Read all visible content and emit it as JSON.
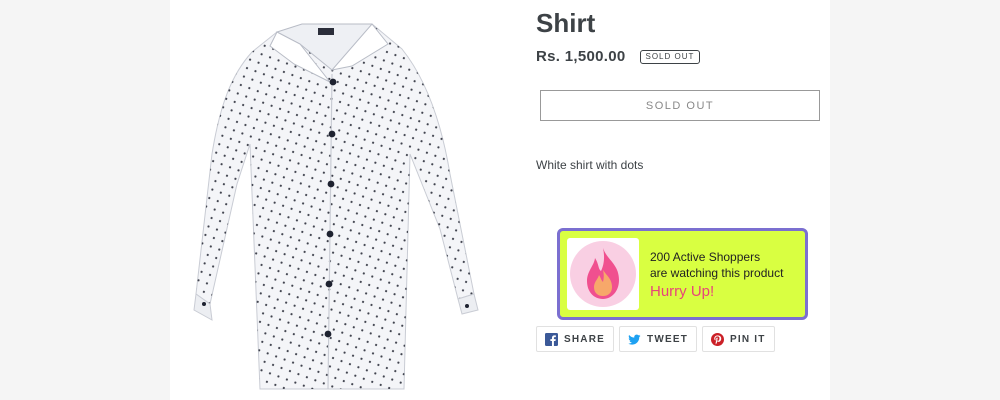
{
  "product": {
    "title": "Shirt",
    "price": "Rs. 1,500.00",
    "badge": "SOLD OUT",
    "button_label": "SOLD OUT",
    "description": "White shirt with dots",
    "image_alt": "white-dotted-shirt"
  },
  "urgency": {
    "count_text": "200 Active Shoppers",
    "sub_text": "are watching this product",
    "cta_text": "Hurry Up!",
    "icon": "fire-icon"
  },
  "share": {
    "share_label": "SHARE",
    "tweet_label": "TWEET",
    "pin_label": "PIN IT"
  }
}
